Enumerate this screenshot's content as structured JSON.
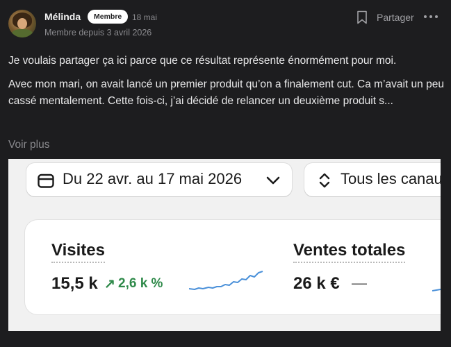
{
  "author": {
    "name": "Mélinda",
    "badge": "Membre",
    "date": "18 mai",
    "member_since": "Membre depuis 3 avril 2026"
  },
  "actions": {
    "share_label": "Partager"
  },
  "post": {
    "paragraph_1": "Je voulais partager ça ici parce que ce résultat représente énormément pour moi.",
    "paragraph_2": "Avec mon mari, on avait lancé un premier produit qu’on a finalement cut. Ca m’avait un peu cassé mentalement. Cette fois-ci, j’ai décidé de relancer un deuxième produit s...",
    "see_more": "Voir plus"
  },
  "attachment": {
    "date_range": "Du 22 avr. au 17 mai 2026",
    "channels": "Tous les canaux",
    "metrics": [
      {
        "label": "Visites",
        "value": "15,5 k",
        "trend_arrow": "↗",
        "trend": "2,6 k %"
      },
      {
        "label": "Ventes totales",
        "value": "26 k €",
        "trend": "—"
      }
    ]
  },
  "colors": {
    "background": "#1d1d1f",
    "trend_green": "#2f8a4a",
    "sparkline_blue": "#4a90d9"
  }
}
